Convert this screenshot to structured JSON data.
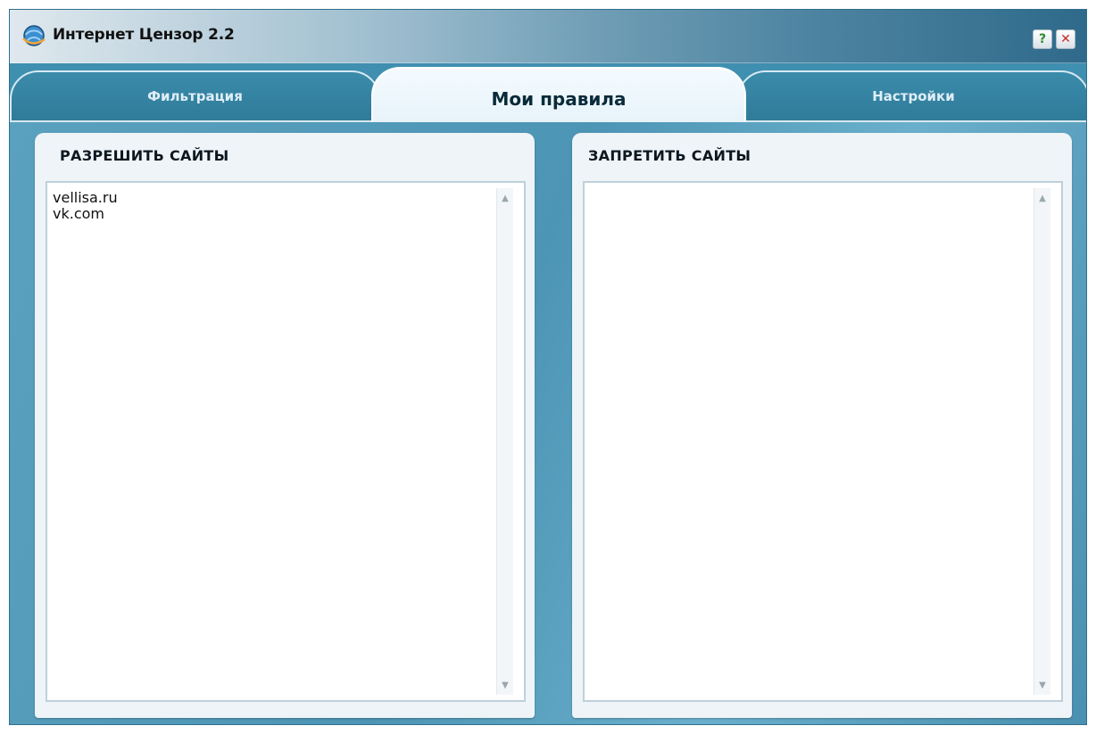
{
  "window": {
    "title": "Интернет Цензор 2.2",
    "help_label": "?",
    "close_label": "✕",
    "app_icon": "globe-icon"
  },
  "tabs": [
    {
      "label": "Фильтрация",
      "active": false
    },
    {
      "label": "Мои правила",
      "active": true
    },
    {
      "label": "Настройки",
      "active": false
    }
  ],
  "allow_panel": {
    "title": "РАЗРЕШИТЬ САЙТЫ",
    "items": [
      "vellisa.ru",
      "vk.com"
    ]
  },
  "block_panel": {
    "title": "ЗАПРЕТИТЬ САЙТЫ",
    "items": []
  },
  "icons": {
    "scroll_up": "▲",
    "scroll_down": "▼"
  },
  "colors": {
    "accent_blue": "#3f8fb0",
    "panel_bg": "#eef4f7",
    "help_green": "#2f8a2f",
    "close_red": "#cc2a2a"
  }
}
